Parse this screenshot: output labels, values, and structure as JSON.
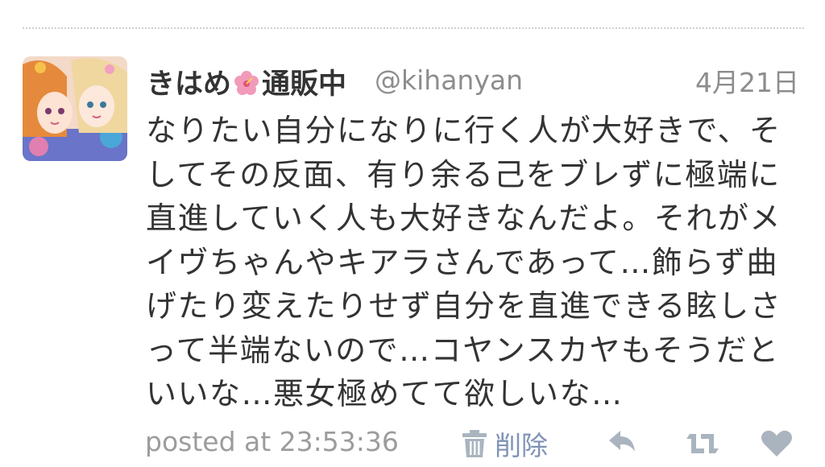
{
  "tweet": {
    "display_name": "きはめ",
    "display_name_suffix": "通販中",
    "handle": "@kihanyan",
    "date": "4月21日",
    "body": "なりたい自分になりに行く人が大好きで、そ\nしてその反面、有り余る己をブレずに極端に\n直進していく人も大好きなんだよ。それがメ\nイヴちゃんやキアラさんであって…飾らず曲\nげたり変えたりせず自分を直進できる眩しさ\nって半端ないので…コヤンスカヤもそうだと\nいいな…悪女極めてて欲しいな…",
    "posted_at": "posted at 23:53:36",
    "delete_label": "削除"
  },
  "icons": {
    "avatar": "avatar-illustration",
    "name_emoji": "hibiscus-icon",
    "delete": "trash-icon",
    "reply": "reply-icon",
    "retweet": "retweet-icon",
    "favorite": "heart-icon"
  },
  "colors": {
    "text": "#333333",
    "meta": "#8d8d8d",
    "delete_link": "#7f93b6",
    "action_icon": "#a9b4bf",
    "divider": "#cfcfcf"
  }
}
